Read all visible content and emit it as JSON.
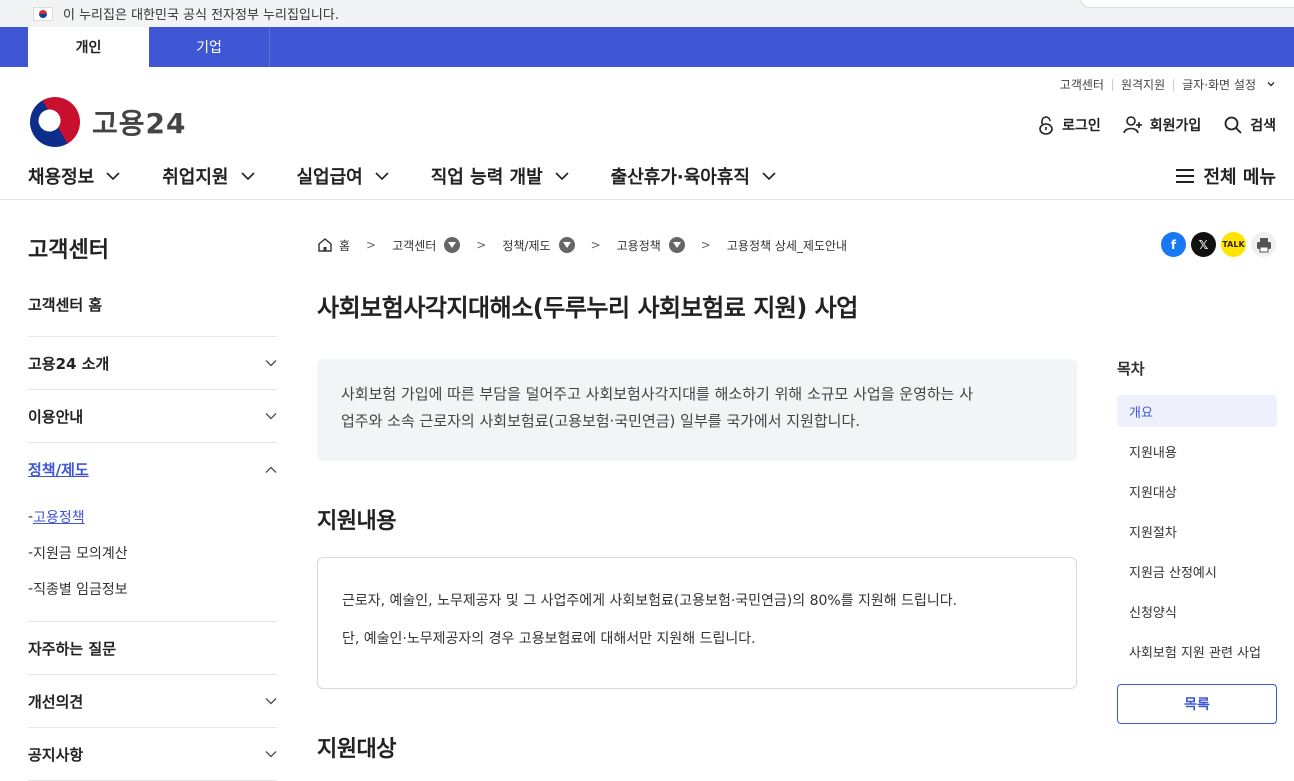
{
  "gov_notice": "이 누리집은 대한민국 공식 전자정부 누리집입니다.",
  "tabs": [
    "개인",
    "기업"
  ],
  "logo_text": "고용24",
  "util_links": [
    "고객센터",
    "원격지원",
    "글자·화면 설정"
  ],
  "account": {
    "login": "로그인",
    "signup": "회원가입",
    "search": "검색"
  },
  "gnb": [
    "채용정보",
    "취업지원",
    "실업급여",
    "직업 능력 개발",
    "출산휴가·육아휴직"
  ],
  "all_menu": "전체 메뉴",
  "sidebar": {
    "title": "고객센터",
    "items": [
      "고객센터 홈",
      "고용24 소개",
      "이용안내",
      "정책/제도",
      "자주하는 질문",
      "개선의견",
      "공지사항"
    ],
    "sub_items": [
      "고용정책",
      "지원금 모의계산",
      "직종별 임금정보"
    ]
  },
  "breadcrumb": [
    "홈",
    "고객센터",
    "정책/제도",
    "고용정책",
    "고용정책 상세_제도안내"
  ],
  "page_title": "사회보험사각지대해소(두루누리 사회보험료 지원) 사업",
  "summary_line1": "사회보험 가입에 따른 부담을 덜어주고 사회보험사각지대를 해소하기 위해 소규모 사업을 운영하는 사",
  "summary_line2": "업주와 소속 근로자의 사회보험료(고용보험·국민연금) 일부를 국가에서 지원합니다.",
  "section1": {
    "title": "지원내용",
    "line1": "근로자, 예술인, 노무제공자 및 그 사업주에게 사회보험료(고용보험·국민연금)의 80%를 지원해 드립니다.",
    "line2": "단, 예술인·노무제공자의 경우 고용보험료에 대해서만 지원해 드립니다."
  },
  "section2_title": "지원대상",
  "toc": {
    "title": "목차",
    "items": [
      "개요",
      "지원내용",
      "지원대상",
      "지원절차",
      "지원금 산정예시",
      "신청양식",
      "사회보험 지원 관련 사업"
    ],
    "list_button": "목록"
  },
  "colors": {
    "brand": "#3f57d4"
  }
}
